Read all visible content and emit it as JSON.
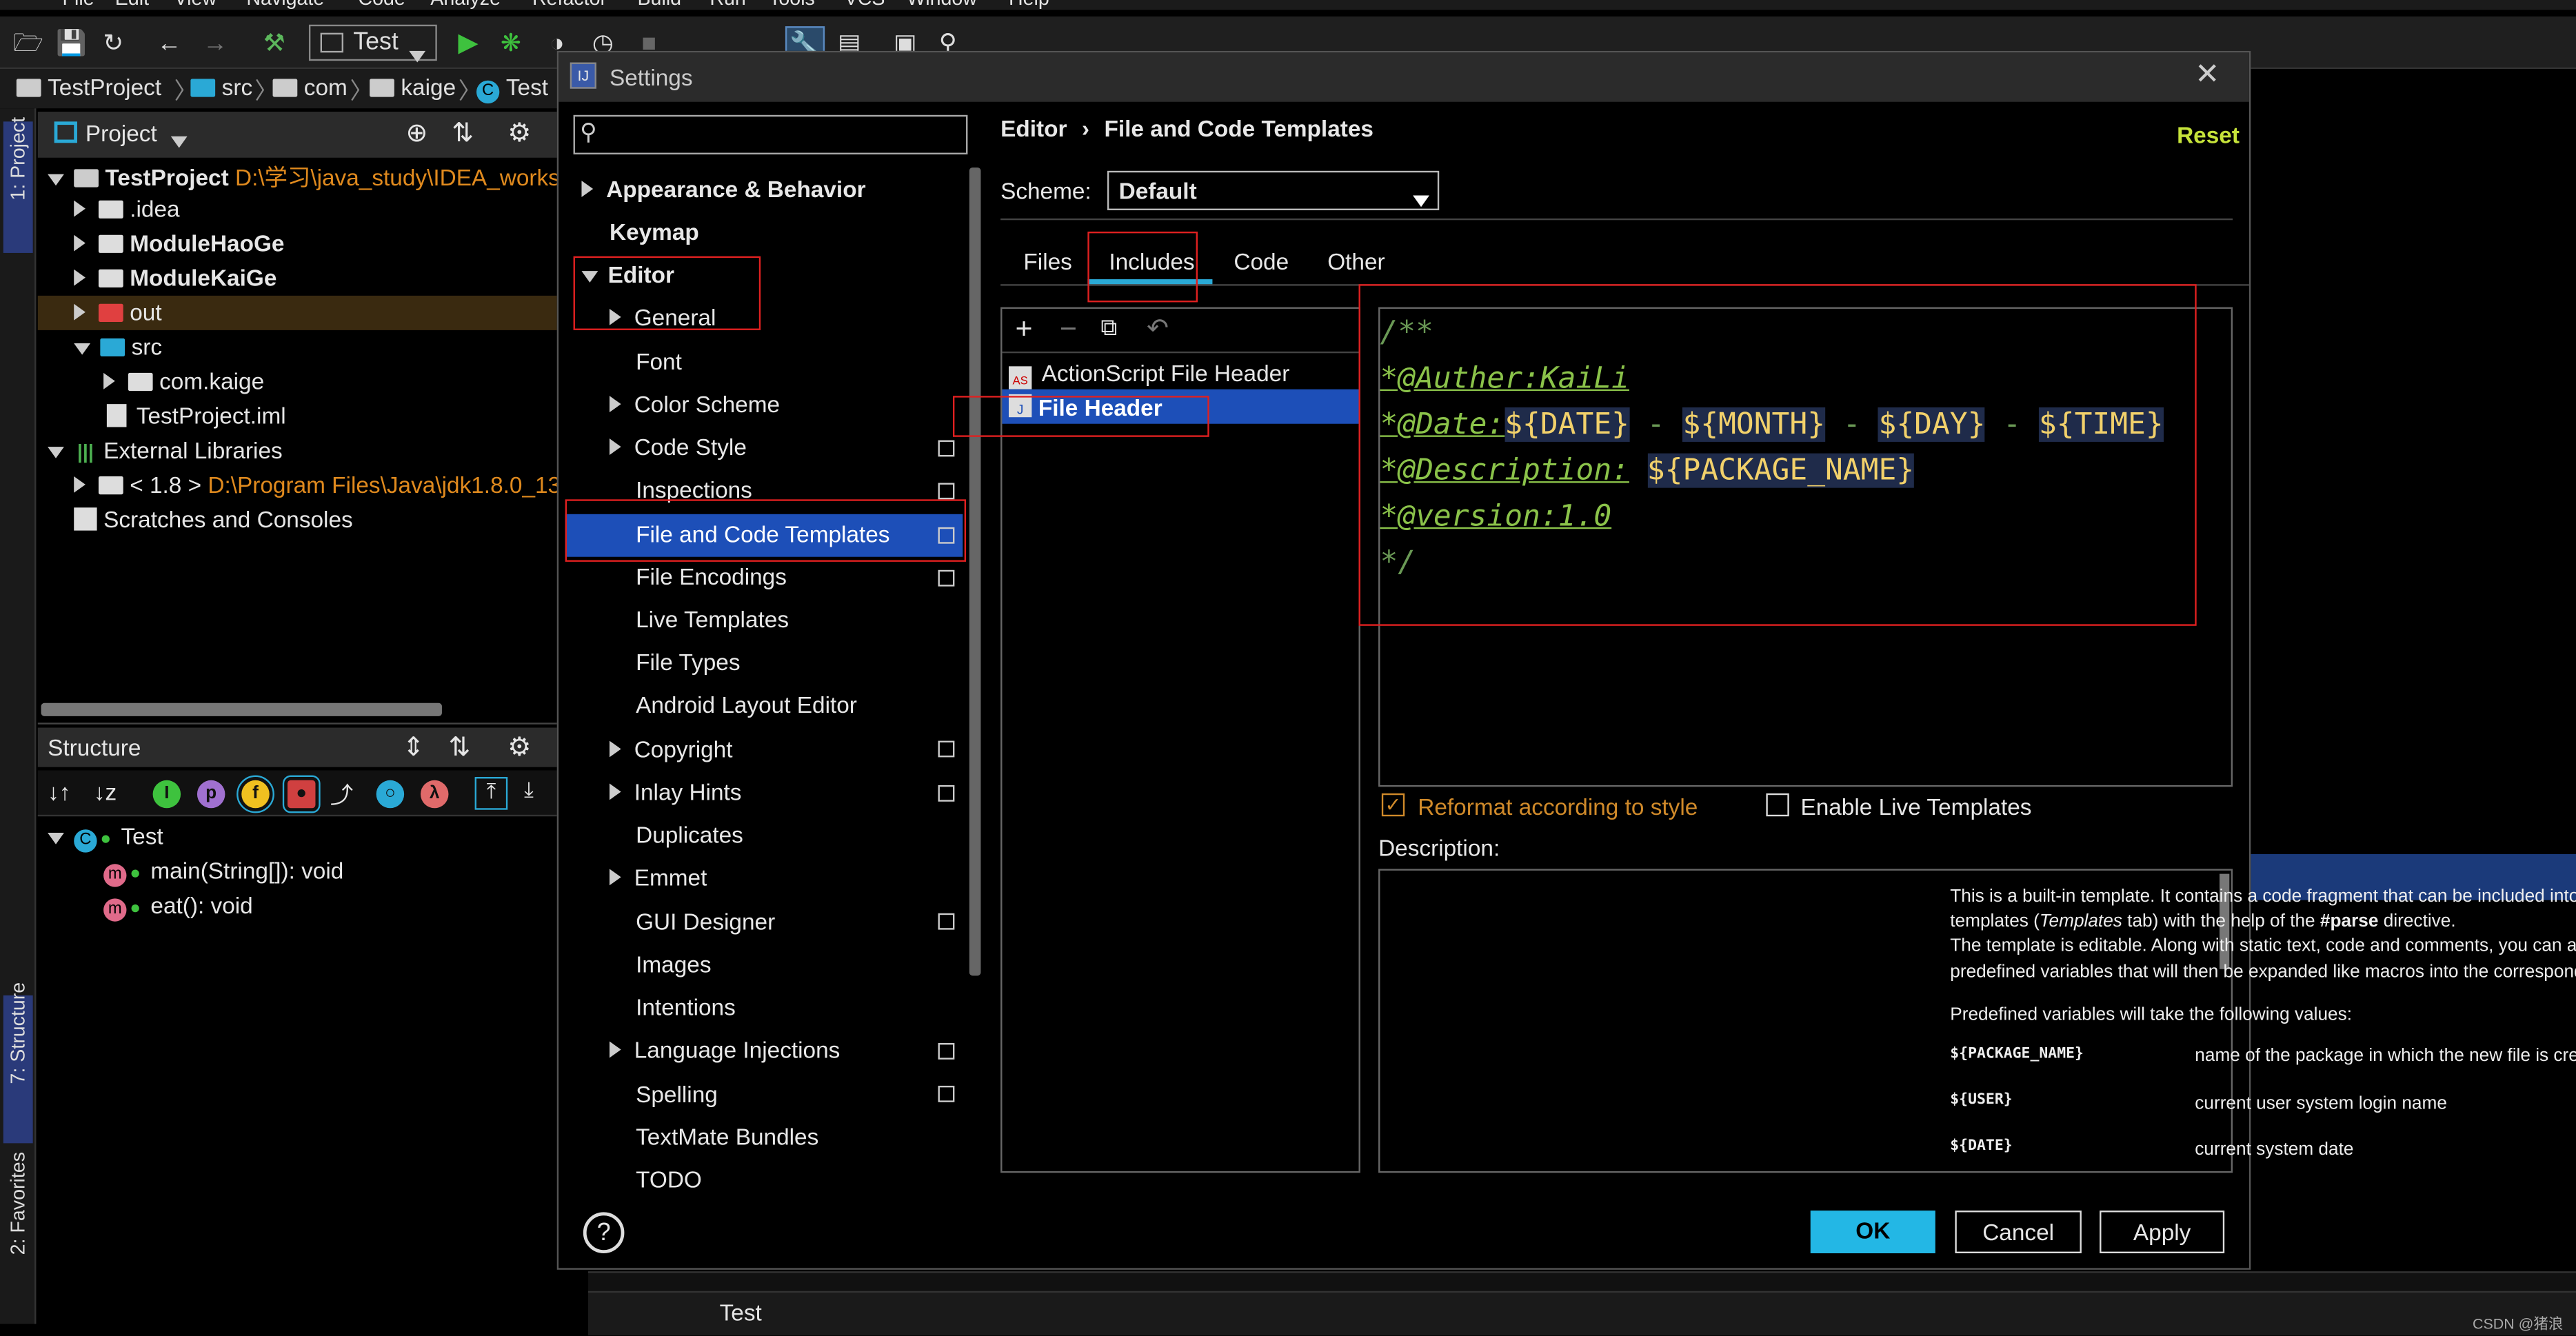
{
  "menubar": {
    "items": [
      "File",
      "Edit",
      "View",
      "Navigate",
      "Code",
      "Analyze",
      "Refactor",
      "Build",
      "Run",
      "Tools",
      "VCS",
      "Window",
      "Help"
    ]
  },
  "toolbar": {
    "run_config": "Test"
  },
  "breadcrumb": [
    "TestProject",
    "src",
    "com",
    "kaige",
    "Test"
  ],
  "sidebar_tabs": {
    "project": "1: Project",
    "structure": "7: Structure",
    "favorites": "2: Favorites"
  },
  "project_panel": {
    "title": "Project",
    "root_name": "TestProject",
    "root_path": "D:\\学习\\java_study\\IDEA_workspa",
    "items": [
      ".idea",
      "ModuleHaoGe",
      "ModuleKaiGe",
      "out",
      "src",
      "com.kaige",
      "TestProject.iml",
      "External Libraries"
    ],
    "jdk_name": "< 1.8 >",
    "jdk_path": "D:\\Program Files\\Java\\jdk1.8.0_13",
    "scratches": "Scratches and Consoles"
  },
  "structure_panel": {
    "title": "Structure",
    "class_name": "Test",
    "members": [
      "main(String[]): void",
      "eat(): void"
    ]
  },
  "dialog": {
    "title": "Settings",
    "search_placeholder": "",
    "breadcrumb": "Editor",
    "breadcrumb_sep": "›",
    "page": "File and Code Templates",
    "reset": "Reset",
    "scheme_label": "Scheme:",
    "scheme_value": "Default",
    "tabs": [
      "Files",
      "Includes",
      "Code",
      "Other"
    ],
    "templates": [
      "ActionScript File Header",
      "File Header"
    ],
    "tree": [
      "Appearance & Behavior",
      "Keymap",
      "Editor",
      "General",
      "Font",
      "Color Scheme",
      "Code Style",
      "Inspections",
      "File and Code Templates",
      "File Encodings",
      "Live Templates",
      "File Types",
      "Android Layout Editor",
      "Copyright",
      "Inlay Hints",
      "Duplicates",
      "Emmet",
      "GUI Designer",
      "Images",
      "Intentions",
      "Language Injections",
      "Spelling",
      "TextMate Bundles",
      "TODO"
    ],
    "code": {
      "l1": "/**",
      "auther": "*@Auther:KaiLi",
      "date_tag": "*@Date:",
      "date_var": "${DATE}",
      "month_var": "${MONTH}",
      "day_var": "${DAY}",
      "time_var": "${TIME}",
      "dash": " - ",
      "desc_tag": "*@Description:",
      "pkg_var": "${PACKAGE_NAME}",
      "version": "*@version:1.0",
      "end": "*/"
    },
    "reformat": "Reformat according to style",
    "live_templates": "Enable Live Templates",
    "description_label": "Description:",
    "description": {
      "p1a": "This is a built-in template. It contains a code fragment that can be included into file",
      "p1b_pre": "templates (",
      "p1b_em": "Templates",
      "p1b_mid": " tab) with the help of the ",
      "p1b_strong": "#parse",
      "p1b_post": " directive.",
      "p2a": "The template is editable. Along with static text, code and comments, you can also use",
      "p2b": "predefined variables that will then be expanded like macros into the corresponding values.",
      "p3": "Predefined variables will take the following values:",
      "vars": [
        {
          "name": "${PACKAGE_NAME}",
          "desc": "name of the package in which the new file is created"
        },
        {
          "name": "${USER}",
          "desc": "current user system login name"
        },
        {
          "name": "${DATE}",
          "desc": "current system date"
        }
      ]
    },
    "buttons": {
      "help": "?",
      "ok": "OK",
      "cancel": "Cancel",
      "apply": "Apply"
    }
  },
  "bottom": {
    "tab": "Test"
  },
  "watermark": "CSDN @猪浪浪"
}
